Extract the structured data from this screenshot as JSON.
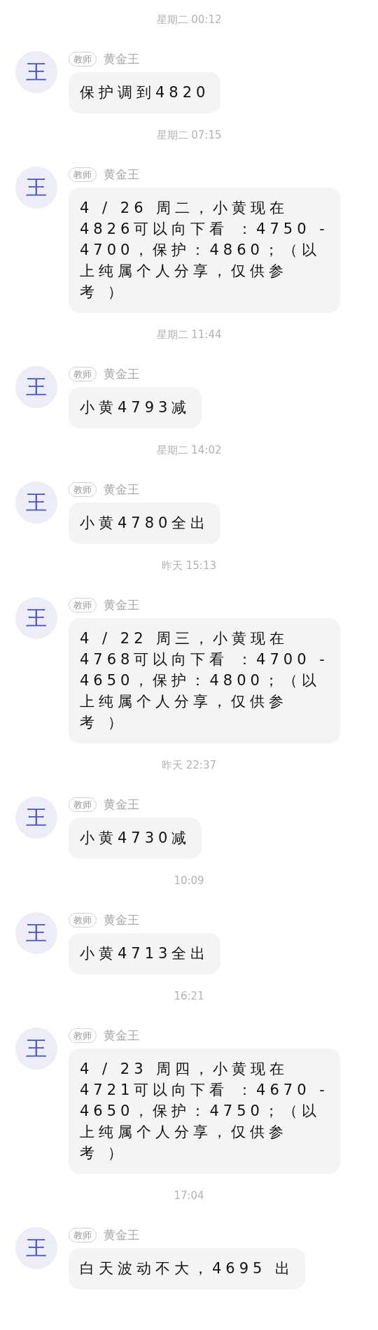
{
  "messages": [
    {
      "time": "星期二 00:12",
      "avatar": "王",
      "role": "教师",
      "sender": "黄金王",
      "lines": [
        "保护调到4820"
      ]
    },
    {
      "time": "星期二 07:15",
      "avatar": "王",
      "role": "教师",
      "sender": "黄金王",
      "lines": [
        "4 / 26 周二，小黄现在",
        "4826可以向下看 ：4750 -",
        "4700，保护：4860；（以",
        "上纯属个人分享，仅供参",
        "考 ）"
      ]
    },
    {
      "time": "星期二 11:44",
      "avatar": "王",
      "role": "教师",
      "sender": "黄金王",
      "lines": [
        "小黄4793减"
      ]
    },
    {
      "time": "星期二 14:02",
      "avatar": "王",
      "role": "教师",
      "sender": "黄金王",
      "lines": [
        "小黄4780全出"
      ]
    },
    {
      "time": "昨天 15:13",
      "avatar": "王",
      "role": "教师",
      "sender": "黄金王",
      "lines": [
        "4 / 22 周三，小黄现在",
        "4768可以向下看 ：4700 -",
        "4650，保护：4800；（以",
        "上纯属个人分享，仅供参",
        "考 ）"
      ]
    },
    {
      "time": "昨天 22:37",
      "avatar": "王",
      "role": "教师",
      "sender": "黄金王",
      "lines": [
        "小黄4730减"
      ]
    },
    {
      "time": "10:09",
      "avatar": "王",
      "role": "教师",
      "sender": "黄金王",
      "lines": [
        "小黄4713全出"
      ]
    },
    {
      "time": "16:21",
      "avatar": "王",
      "role": "教师",
      "sender": "黄金王",
      "lines": [
        "4 / 23 周四，小黄现在",
        "4721可以向下看 ：4670 -",
        "4650，保护：4750；（以",
        "上纯属个人分享，仅供参",
        "考 ）"
      ]
    },
    {
      "time": "17:04",
      "avatar": "王",
      "role": "教师",
      "sender": "黄金王",
      "lines": [
        "白天波动不大，4695 出"
      ]
    }
  ]
}
